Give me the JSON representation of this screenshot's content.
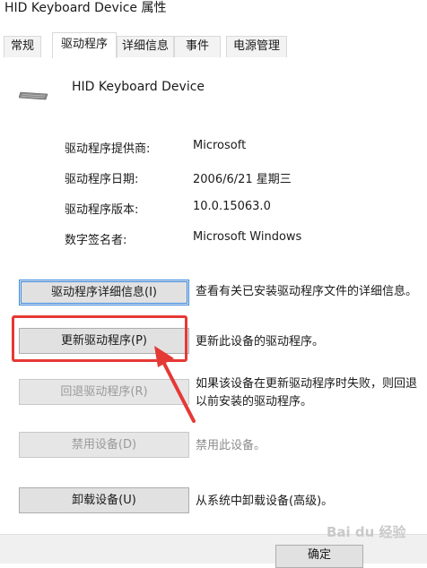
{
  "window": {
    "title": "HID Keyboard Device 属性"
  },
  "tabs": [
    {
      "label": "常规"
    },
    {
      "label": "驱动程序"
    },
    {
      "label": "详细信息"
    },
    {
      "label": "事件"
    },
    {
      "label": "电源管理"
    }
  ],
  "device": {
    "name": "HID Keyboard Device",
    "icon": "keyboard-icon"
  },
  "info": [
    {
      "label": "驱动程序提供商:",
      "value": "Microsoft"
    },
    {
      "label": "驱动程序日期:",
      "value": "2006/6/21 星期三"
    },
    {
      "label": "驱动程序版本:",
      "value": "10.0.15063.0"
    },
    {
      "label": "数字签名者:",
      "value": "Microsoft Windows"
    }
  ],
  "actions": [
    {
      "button": "驱动程序详细信息(I)",
      "desc": "查看有关已安装驱动程序文件的详细信息。"
    },
    {
      "button": "更新驱动程序(P)",
      "desc": "更新此设备的驱动程序。"
    },
    {
      "button": "回退驱动程序(R)",
      "desc_line1": "如果该设备在更新驱动程序时失败，则回退",
      "desc_line2": "以前安装的驱动程序。"
    },
    {
      "button": "禁用设备(D)",
      "desc": "禁用此设备。"
    },
    {
      "button": "卸载设备(U)",
      "desc": "从系统中卸载设备(高级)。"
    }
  ],
  "footer": {
    "ok_label": "确定",
    "watermark": "Bai du 经验"
  },
  "colors": {
    "highlight": "#e53935",
    "focus": "#3c8de6"
  }
}
